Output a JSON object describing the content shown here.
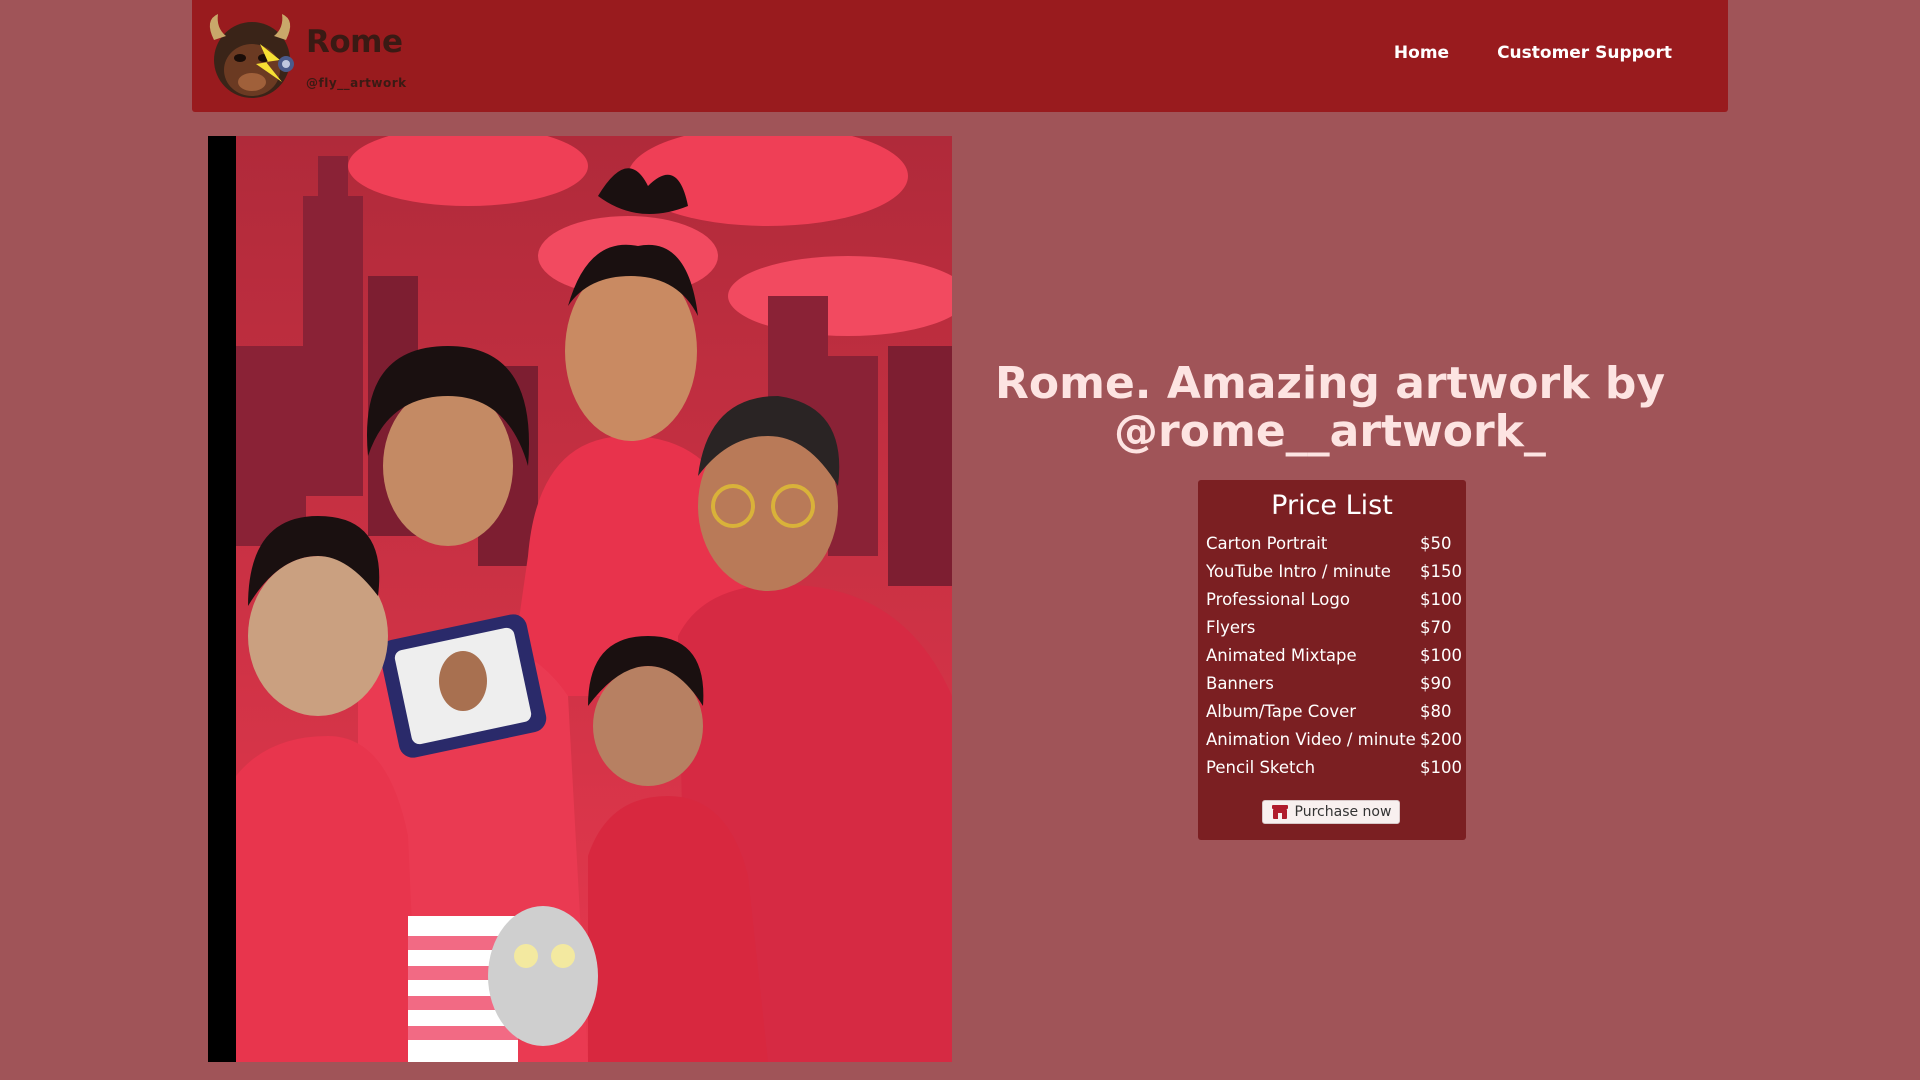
{
  "brand": {
    "name": "Rome",
    "handle": "@fly__artwork"
  },
  "nav": {
    "links": [
      "Home",
      "Customer Support"
    ]
  },
  "colors": {
    "navbar": "#991b1e",
    "page_background": "#a05458",
    "card_background": "#7b1f22",
    "title_text": "#fde4e2"
  },
  "hero": {
    "title": "Rome. Amazing artwork by @rome__artwork_"
  },
  "price_list": {
    "title": "Price List",
    "items": [
      {
        "name": "Carton Portrait",
        "price": "$50"
      },
      {
        "name": "YouTube Intro / minute",
        "price": "$150"
      },
      {
        "name": "Professional Logo",
        "price": "$100"
      },
      {
        "name": "Flyers",
        "price": "$70"
      },
      {
        "name": "Animated Mixtape",
        "price": "$100"
      },
      {
        "name": "Banners",
        "price": "$90"
      },
      {
        "name": "Album/Tape Cover",
        "price": "$80"
      },
      {
        "name": "Animation Video / minute",
        "price": "$200"
      },
      {
        "name": "Pencil Sketch",
        "price": "$100"
      }
    ],
    "purchase_label": "Purchase now",
    "purchase_icon": "shop-icon"
  },
  "artwork": {
    "icon": "family-portrait-illustration"
  }
}
